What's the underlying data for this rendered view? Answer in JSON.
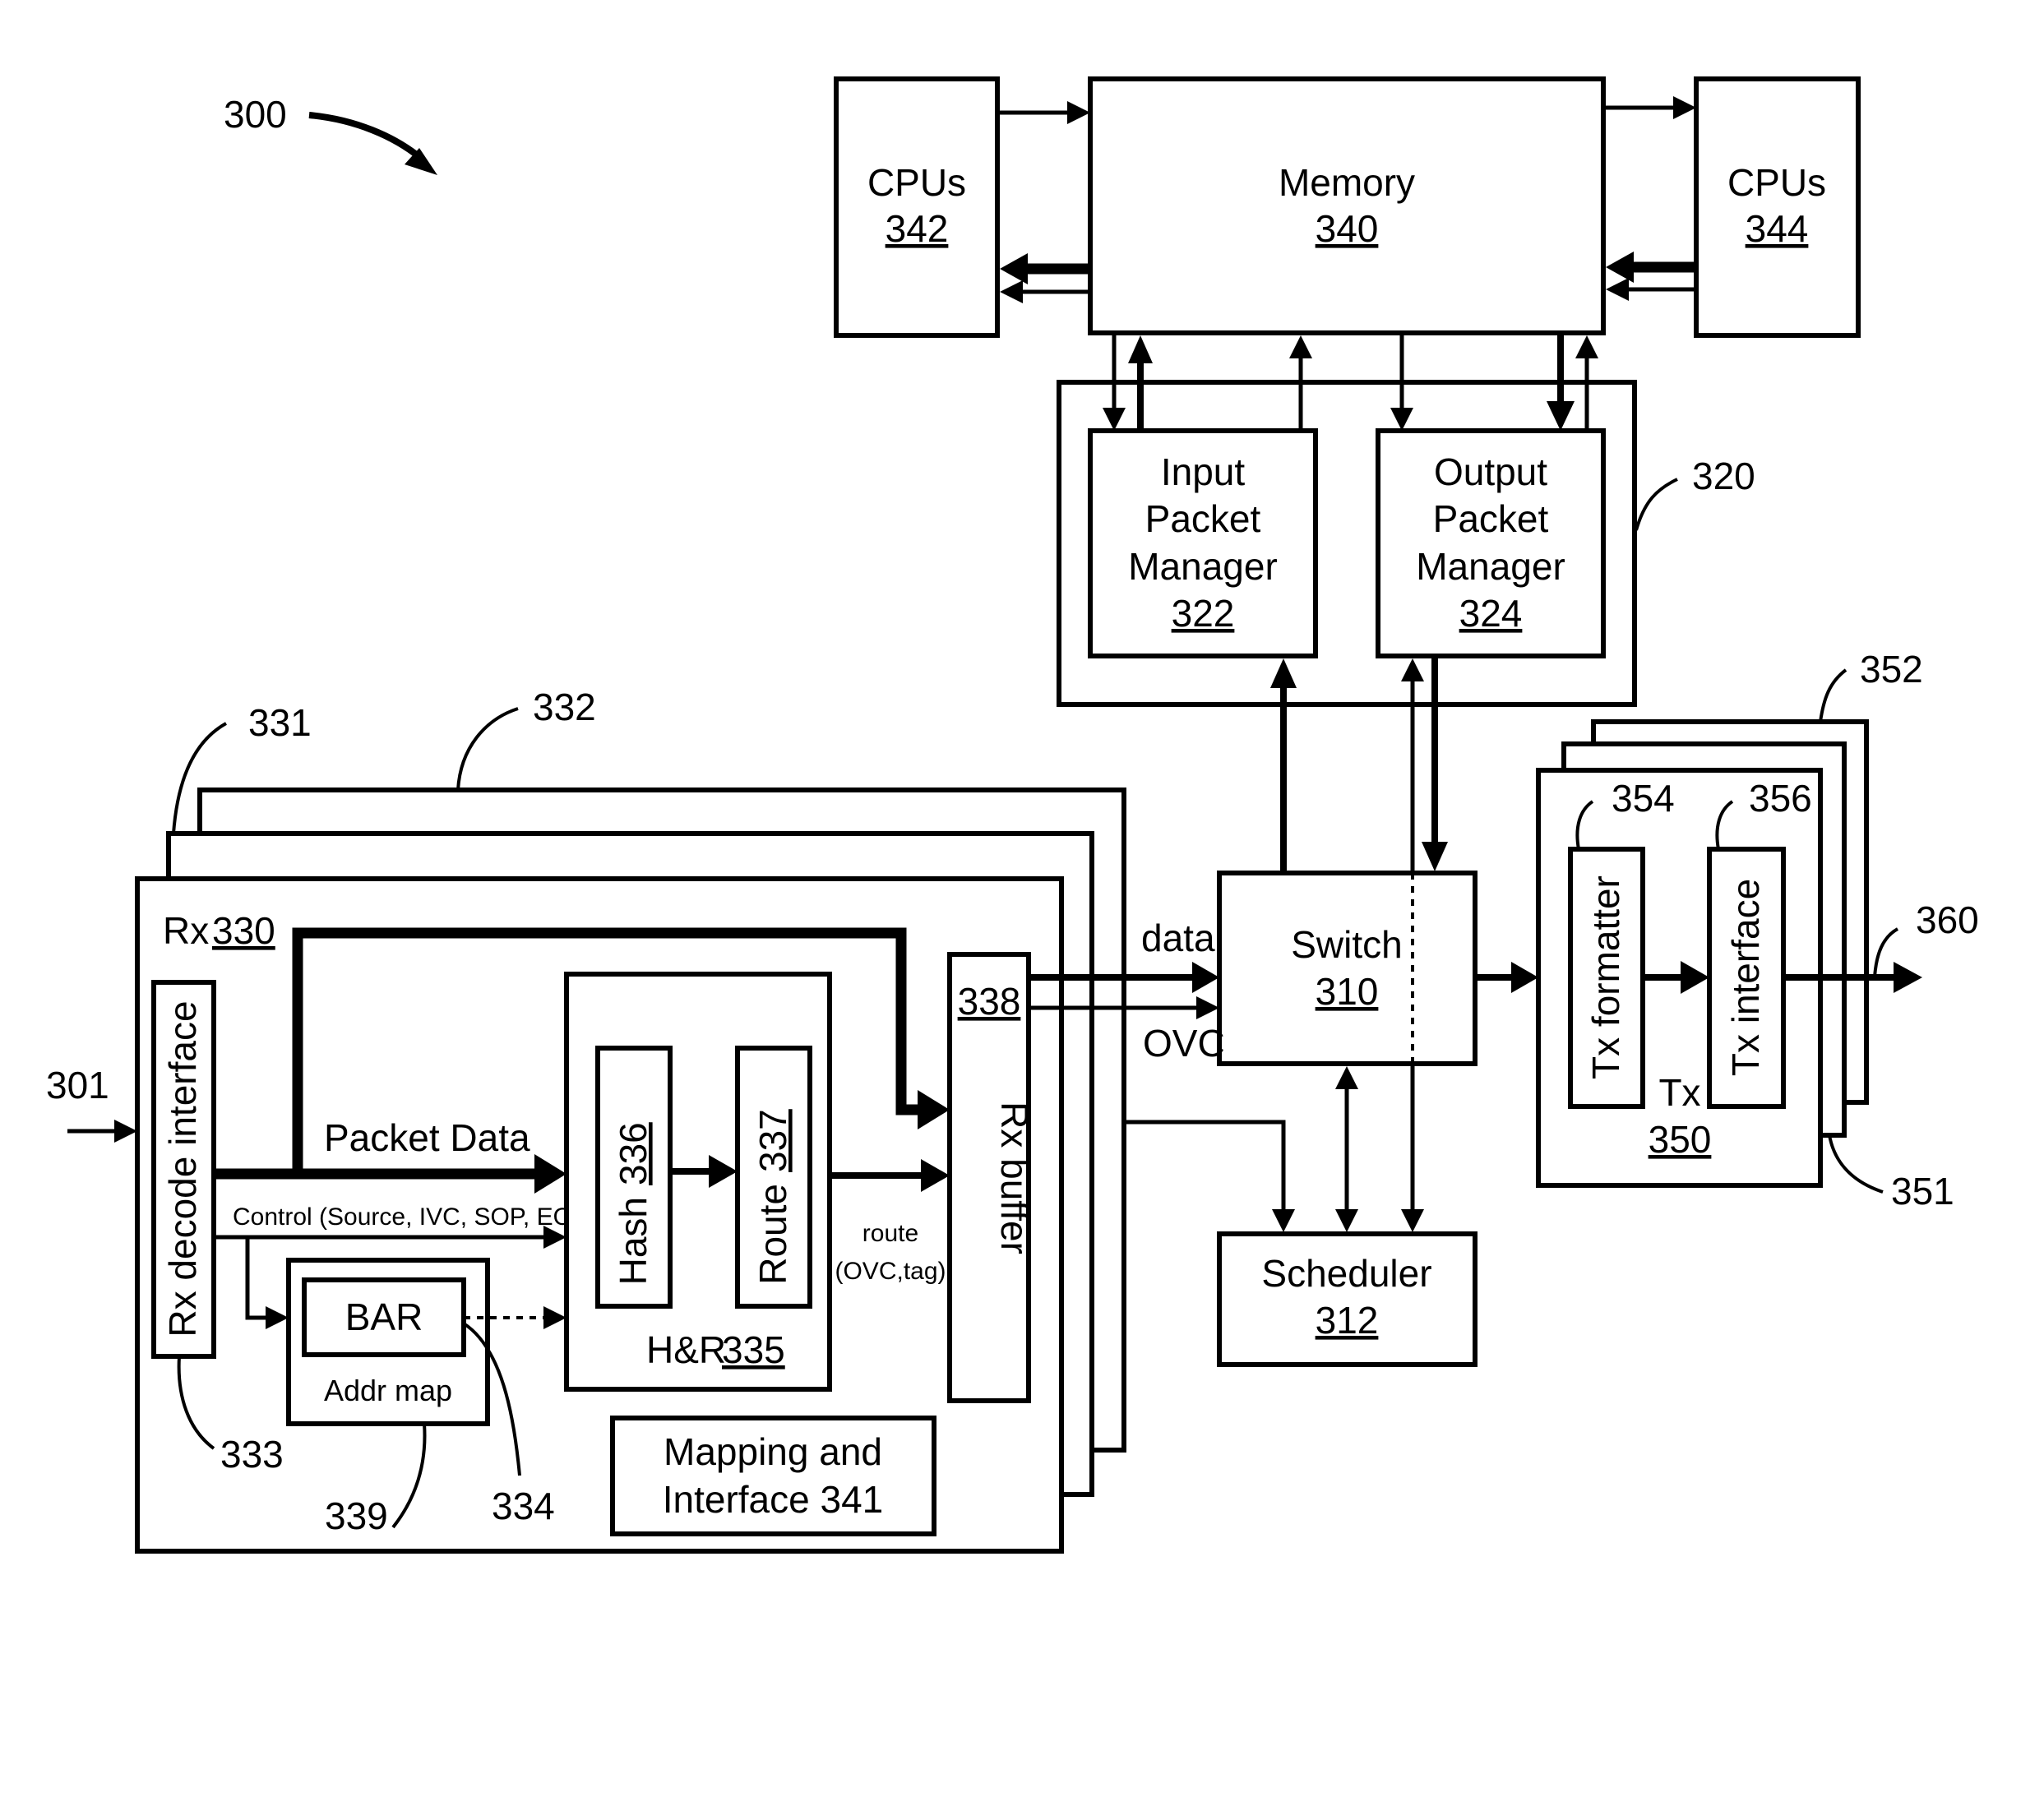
{
  "figure": {
    "number": "300",
    "colors": {
      "line": "#000000",
      "background": "#ffffff"
    }
  },
  "memory": {
    "title": "Memory",
    "ref": "340"
  },
  "cpus_left": {
    "title": "CPUs",
    "ref": "342"
  },
  "cpus_right": {
    "title": "CPUs",
    "ref": "344"
  },
  "packet_manager_group": {
    "ref": "320"
  },
  "input_packet_manager": {
    "lines": [
      "Input",
      "Packet",
      "Manager"
    ],
    "ref": "322"
  },
  "output_packet_manager": {
    "lines": [
      "Output",
      "Packet",
      "Manager"
    ],
    "ref": "324"
  },
  "switch": {
    "title": "Switch",
    "ref": "310"
  },
  "scheduler": {
    "title": "Scheduler",
    "ref": "312"
  },
  "rx": {
    "title": "Rx",
    "ref": "330",
    "stack_refs": [
      "331",
      "332"
    ],
    "input_ref": "301",
    "decode_interface": {
      "label": "Rx decode interface",
      "ref": "333"
    },
    "packet_data_label": "Packet Data",
    "control_label": "Control (Source, IVC, SOP, EOP)",
    "addr_map": {
      "label": "Addr map",
      "ref": "339"
    },
    "bar": {
      "label": "BAR",
      "ref": "334"
    },
    "hash_route": {
      "title": "H&R",
      "ref": "335"
    },
    "hash": {
      "label": "Hash",
      "ref": "336"
    },
    "route": {
      "label": "Route",
      "ref": "337"
    },
    "route_output_label_1": "route",
    "route_output_label_2": "(OVC,tag)",
    "rx_buffer": {
      "label": "Rx buffer",
      "ref": "338"
    },
    "mapping": {
      "lines": [
        "Mapping and",
        "Interface 341"
      ]
    },
    "data_label": "data",
    "ovc_label": "OVC"
  },
  "tx": {
    "title": "Tx",
    "ref": "350",
    "stack_refs": [
      "351",
      "352"
    ],
    "output_ref": "360",
    "formatter": {
      "label": "Tx formatter",
      "ref": "354"
    },
    "interface": {
      "label": "Tx interface",
      "ref": "356"
    }
  }
}
